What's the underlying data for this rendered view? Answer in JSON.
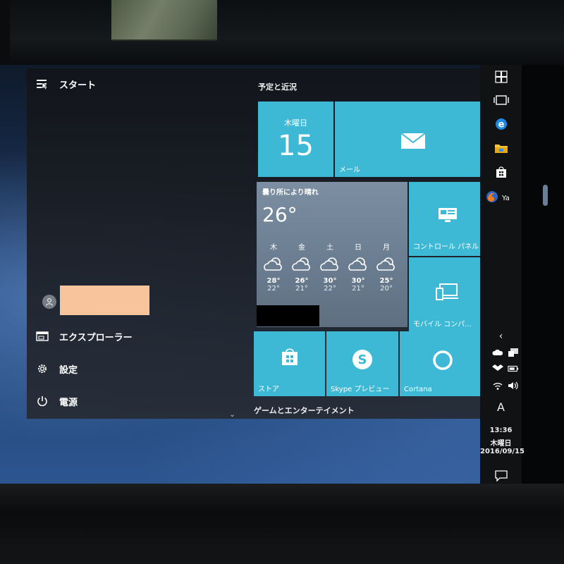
{
  "start_menu": {
    "title": "スタート",
    "user_name": "",
    "items": [
      {
        "label": "エクスプローラー"
      },
      {
        "label": "設定"
      },
      {
        "label": "電源"
      }
    ]
  },
  "tile_groups": [
    {
      "title": "予定と近況"
    },
    {
      "title": "ゲームとエンターテイメント"
    }
  ],
  "tiles": {
    "calendar": {
      "day_name": "木曜日",
      "day_number": "15"
    },
    "mail": {
      "label": "メール"
    },
    "weather": {
      "title": "曇り所により晴れ",
      "temperature": "26°",
      "forecast": [
        {
          "day": "木",
          "high": "28°",
          "low": "22°",
          "icon": "partly-cloudy-icon"
        },
        {
          "day": "金",
          "high": "26°",
          "low": "21°",
          "icon": "partly-cloudy-icon"
        },
        {
          "day": "土",
          "high": "30°",
          "low": "22°",
          "icon": "partly-cloudy-icon"
        },
        {
          "day": "日",
          "high": "30°",
          "low": "21°",
          "icon": "partly-cloudy-icon"
        },
        {
          "day": "月",
          "high": "25°",
          "low": "20°",
          "icon": "partly-cloudy-icon"
        }
      ]
    },
    "control_panel": {
      "label": "コントロール パネル"
    },
    "mobile": {
      "label": "モバイル コンパ..."
    },
    "store": {
      "label": "ストア"
    },
    "skype": {
      "label": "Skype プレビュー"
    },
    "cortana": {
      "label": "Cortana"
    }
  },
  "taskbar": {
    "firefox_label": "Ya",
    "ime_mode": "A",
    "clock": {
      "time": "13:36",
      "day": "木曜日",
      "date": "2016/09/15"
    }
  },
  "colors": {
    "tile_accent": "#3db9d6",
    "weather_tile": "#6b7d90",
    "start_bg": "#1c2027",
    "taskbar_bg": "#101214"
  }
}
